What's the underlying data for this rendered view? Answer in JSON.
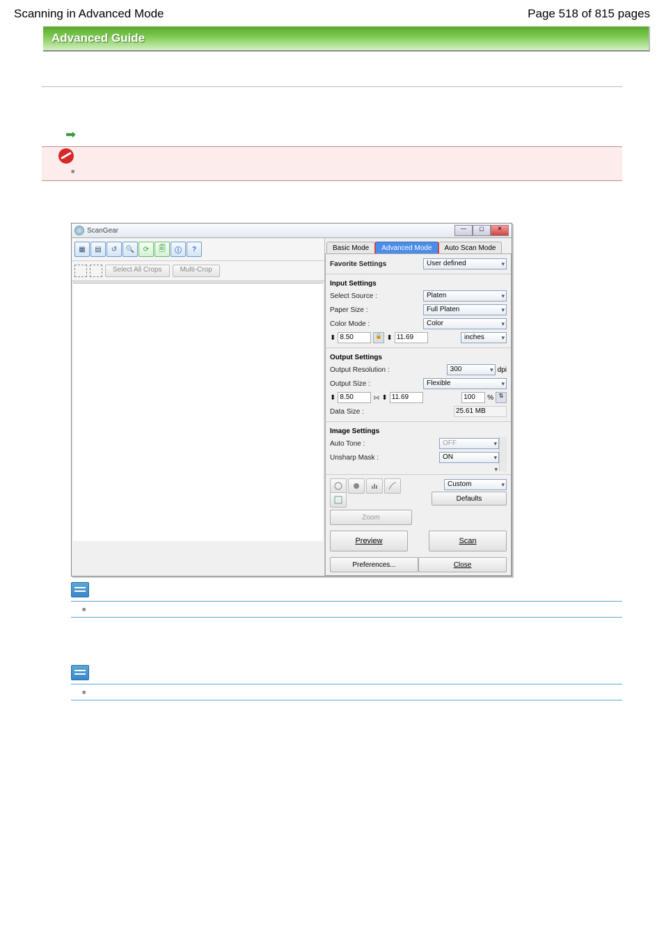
{
  "header": {
    "left": "Scanning in Advanced Mode",
    "right": "Page 518 of 815 pages"
  },
  "banner": {
    "title": "Advanced Guide"
  },
  "window": {
    "title": "ScanGear",
    "toolbar_icons": [
      "thumb-grid-icon",
      "thumb-list-icon",
      "rotate-left-icon",
      "zoom-icon",
      "info-icon",
      "copy-icon",
      "help-icon"
    ],
    "crop_row": {
      "select_all": "Select All Crops",
      "multi_crop": "Multi-Crop"
    },
    "tabs": {
      "basic": "Basic Mode",
      "advanced": "Advanced Mode",
      "auto": "Auto Scan Mode"
    },
    "favorite": {
      "label": "Favorite Settings",
      "value": "User defined"
    },
    "input": {
      "section": "Input Settings",
      "source_label": "Select Source :",
      "source_value": "Platen",
      "paper_label": "Paper Size :",
      "paper_value": "Full Platen",
      "color_label": "Color Mode :",
      "color_value": "Color",
      "w": "8.50",
      "h": "11.69",
      "unit": "inches"
    },
    "output": {
      "section": "Output Settings",
      "res_label": "Output Resolution :",
      "res_value": "300",
      "res_unit": "dpi",
      "size_label": "Output Size :",
      "size_value": "Flexible",
      "w": "8.50",
      "h": "11.69",
      "ratio": "100",
      "pct": "%",
      "data_label": "Data Size :",
      "data_value": "25.61 MB"
    },
    "image": {
      "section": "Image Settings",
      "auto_tone_label": "Auto Tone :",
      "auto_tone_value": "OFF",
      "unsharp_label": "Unsharp Mask :",
      "unsharp_value": "ON"
    },
    "adjust": {
      "custom": "Custom",
      "defaults": "Defaults"
    },
    "buttons": {
      "zoom": "Zoom",
      "preview": "Preview",
      "scan": "Scan",
      "preferences": "Preferences...",
      "close": "Close"
    }
  }
}
